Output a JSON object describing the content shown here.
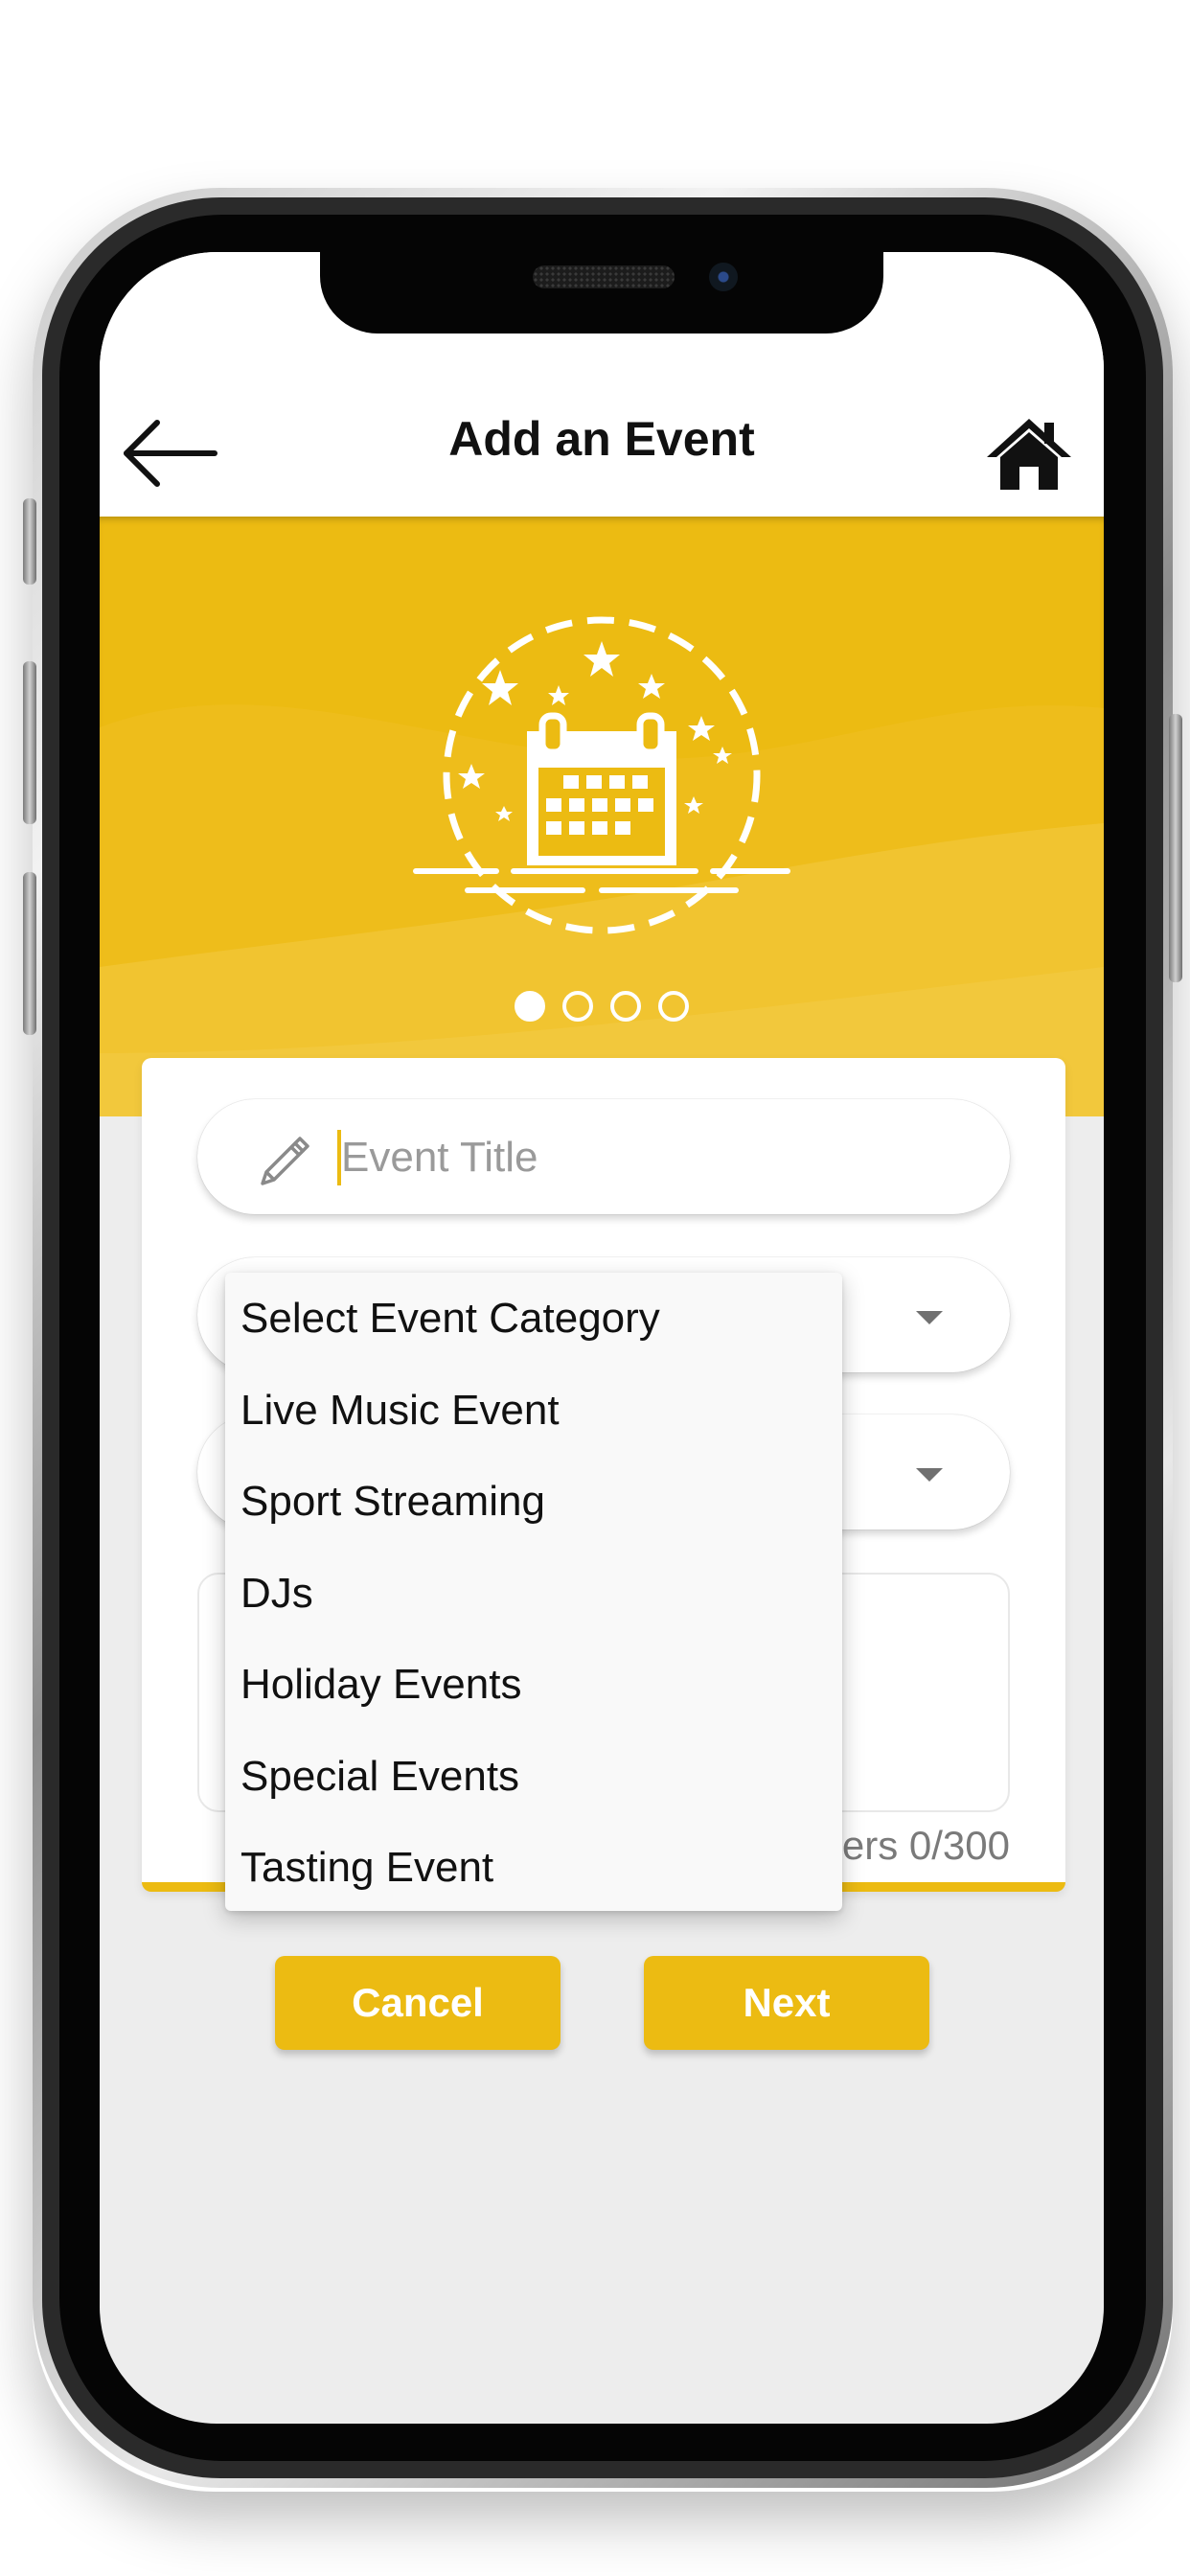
{
  "header": {
    "title": "Add an Event",
    "back_icon": "arrow-left-icon",
    "home_icon": "home-icon"
  },
  "banner": {
    "illustration": "calendar-stars-icon",
    "pager": {
      "total": 4,
      "active": 1
    }
  },
  "form": {
    "title_placeholder": "Event Title",
    "title_icon": "pencil-icon",
    "category_dropdown_icon": "caret-down-icon",
    "second_dropdown_icon": "caret-down-icon",
    "char_counter": "ers 0/300"
  },
  "category_menu": {
    "items": [
      {
        "label": "Select Event Category"
      },
      {
        "label": "Live Music Event"
      },
      {
        "label": "Sport Streaming"
      },
      {
        "label": "DJs"
      },
      {
        "label": "Holiday Events"
      },
      {
        "label": "Special Events"
      },
      {
        "label": "Tasting Event"
      }
    ]
  },
  "actions": {
    "cancel_label": "Cancel",
    "next_label": "Next"
  },
  "colors": {
    "accent": "#ecbb12",
    "screen_bg": "#ededed",
    "header_bg": "#ffffff"
  }
}
